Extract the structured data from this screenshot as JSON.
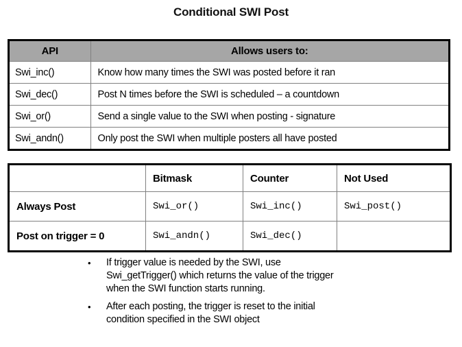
{
  "slide": {
    "title": "Conditional SWI Post"
  },
  "api_table": {
    "headers": [
      "API",
      "Allows users to:"
    ],
    "header_bg": "#a6a6a6",
    "rows": [
      {
        "api": "Swi_inc()",
        "desc": "Know how many times the SWI was posted before it ran"
      },
      {
        "api": "Swi_dec()",
        "desc": "Post N times before the SWI is scheduled – a countdown"
      },
      {
        "api": "Swi_or()",
        "desc": "Send a single value to the SWI when posting - signature"
      },
      {
        "api": "Swi_andn()",
        "desc": "Only post the SWI when multiple posters all have posted"
      }
    ]
  },
  "matrix_table": {
    "headers": [
      "",
      "Bitmask",
      "Counter",
      "Not Used"
    ],
    "rows": [
      {
        "label": "Always Post",
        "bitmask": "Swi_or()",
        "counter": "Swi_inc()",
        "not_used": "Swi_post()"
      },
      {
        "label": "Post on trigger = 0",
        "bitmask": "Swi_andn()",
        "counter": "Swi_dec()",
        "not_used": ""
      }
    ]
  },
  "bullets": {
    "marker": "•",
    "items": [
      "If trigger value is needed by the SWI, use\nSwi_getTrigger() which returns the value of the trigger\nwhen the SWI function starts running.",
      "After each posting, the trigger is reset to the initial\ncondition specified in the SWI object"
    ]
  }
}
